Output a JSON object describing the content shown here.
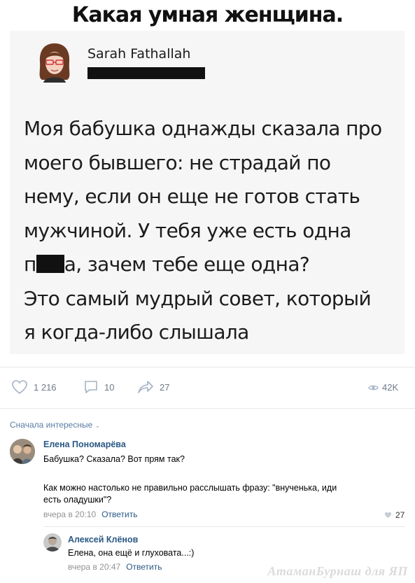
{
  "headline": "Какая умная женщина.",
  "tweet": {
    "author": "Sarah Fathallah",
    "lines": [
      "Моя бабушка однажды сказала про",
      "моего бывшего: не страдай по",
      "нему, если он еще не готов стать",
      "мужчиной. У тебя уже есть одна"
    ],
    "line5_start": "п",
    "line5_end": "а, зачем тебе еще одна?",
    "lines_after": [
      "Это самый мудрый совет, который",
      "я когда-либо слышала"
    ]
  },
  "actions": {
    "likes": "1 216",
    "comments": "10",
    "shares": "27",
    "views": "42K"
  },
  "comments": {
    "sort_label": "Сначала интересные",
    "items": [
      {
        "author": "Елена Пономарёва",
        "text1": "Бабушка? Сказала? Вот прям так?",
        "text2_line1": "Как можно настолько не правильно расслышать фразу: \"внученька, иди",
        "text2_line2": "есть оладушки\"?",
        "time": "вчера в 20:10",
        "reply": "Ответить",
        "likes": "27"
      },
      {
        "author": "Алексей Клёнов",
        "text": "Елена, она ещё и глуховата...:)",
        "time": "вчера в 20:47",
        "reply": "Ответить"
      }
    ]
  },
  "watermark": "АтаманБурнаш для ЯП",
  "colors": {
    "link": "#2a5885",
    "meta": "#939393",
    "tweet_bg": "#f6f6f6"
  }
}
